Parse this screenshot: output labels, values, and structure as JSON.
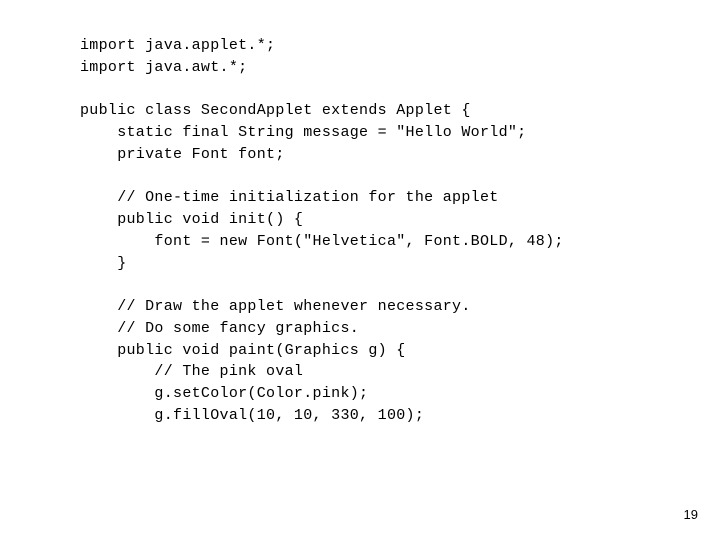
{
  "code": {
    "l01": "import java.applet.*;",
    "l02": "import java.awt.*;",
    "l03": "",
    "l04": "public class SecondApplet extends Applet {",
    "l05": "    static final String message = \"Hello World\";",
    "l06": "    private Font font;",
    "l07": "",
    "l08": "    // One-time initialization for the applet",
    "l09": "    public void init() {",
    "l10": "        font = new Font(\"Helvetica\", Font.BOLD, 48);",
    "l11": "    }",
    "l12": "",
    "l13": "    // Draw the applet whenever necessary.",
    "l14": "    // Do some fancy graphics.",
    "l15": "    public void paint(Graphics g) {",
    "l16": "        // The pink oval",
    "l17": "        g.setColor(Color.pink);",
    "l18": "        g.fillOval(10, 10, 330, 100);"
  },
  "page_number": "19"
}
